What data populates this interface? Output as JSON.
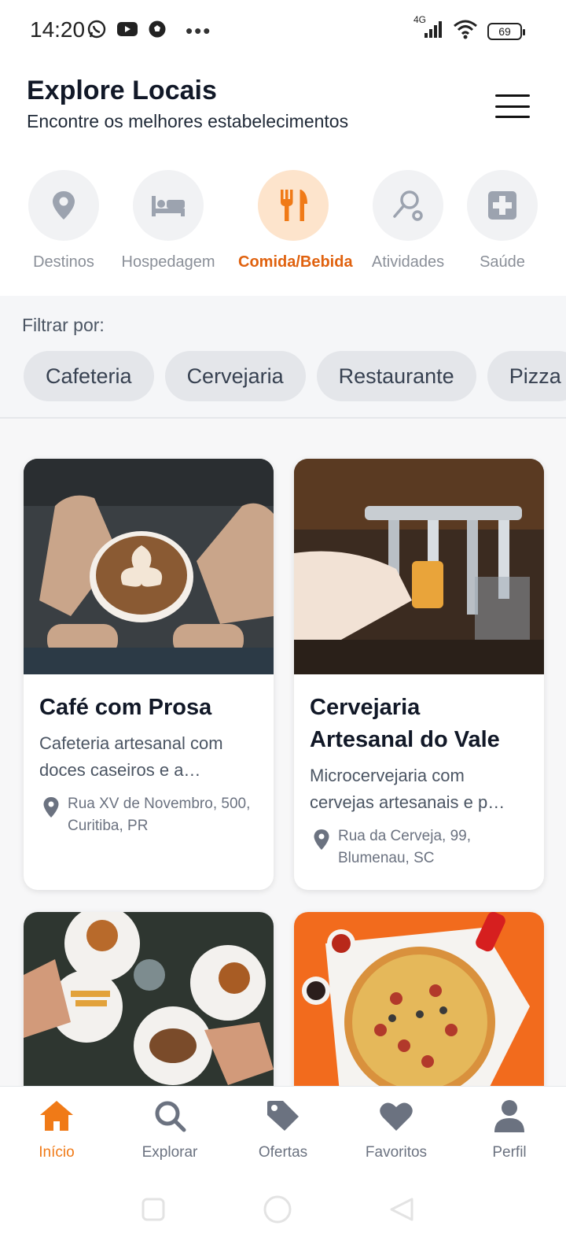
{
  "status_bar": {
    "time": "14:20",
    "network": "4G",
    "battery": "69",
    "icons_left": [
      "whatsapp-icon",
      "youtube-icon",
      "soccer-ball-icon",
      "more-dots-icon"
    ],
    "icons_right": [
      "signal-icon",
      "wifi-icon",
      "battery-icon"
    ]
  },
  "header": {
    "title": "Explore Locais",
    "subtitle": "Encontre os melhores estabelecimentos",
    "menu_icon": "hamburger-menu-icon"
  },
  "categories": [
    {
      "label": "Destinos",
      "icon": "map-pin-icon",
      "active": false
    },
    {
      "label": "Hospedagem",
      "icon": "bed-icon",
      "active": false
    },
    {
      "label": "Comida/Bebida",
      "icon": "utensils-icon",
      "active": true
    },
    {
      "label": "Atividades",
      "icon": "route-icon",
      "active": false
    },
    {
      "label": "Saúde",
      "icon": "medical-plus-icon",
      "active": false
    }
  ],
  "filter": {
    "label": "Filtrar por:",
    "chips": [
      "Cafeteria",
      "Cervejaria",
      "Restaurante",
      "Pizza"
    ]
  },
  "cards": [
    {
      "title": "Café com Prosa",
      "description": "Cafeteria artesanal com doces caseiros e a…",
      "address": "Rua XV de Novembro, 500, Curitiba, PR",
      "image": "latte-art-coffee-photo"
    },
    {
      "title": "Cervejaria Artesanal do Vale",
      "description": "Microcervejaria com cervejas artesanais e p…",
      "address": "Rua da Cerveja, 99, Blumenau, SC",
      "image": "beer-tap-photo"
    },
    {
      "title": "",
      "description": "",
      "address": "",
      "image": "burgers-table-photo"
    },
    {
      "title": "",
      "description": "",
      "address": "",
      "image": "pizza-photo"
    }
  ],
  "bottom_nav": [
    {
      "label": "Início",
      "icon": "home-icon",
      "active": true
    },
    {
      "label": "Explorar",
      "icon": "search-icon",
      "active": false
    },
    {
      "label": "Ofertas",
      "icon": "tag-icon",
      "active": false
    },
    {
      "label": "Favoritos",
      "icon": "heart-icon",
      "active": false
    },
    {
      "label": "Perfil",
      "icon": "user-icon",
      "active": false
    }
  ],
  "colors": {
    "accent": "#f07a17",
    "active_category_text": "#e0620f",
    "active_category_bg": "#fde4cc",
    "inactive_icon": "#9ca3af"
  }
}
